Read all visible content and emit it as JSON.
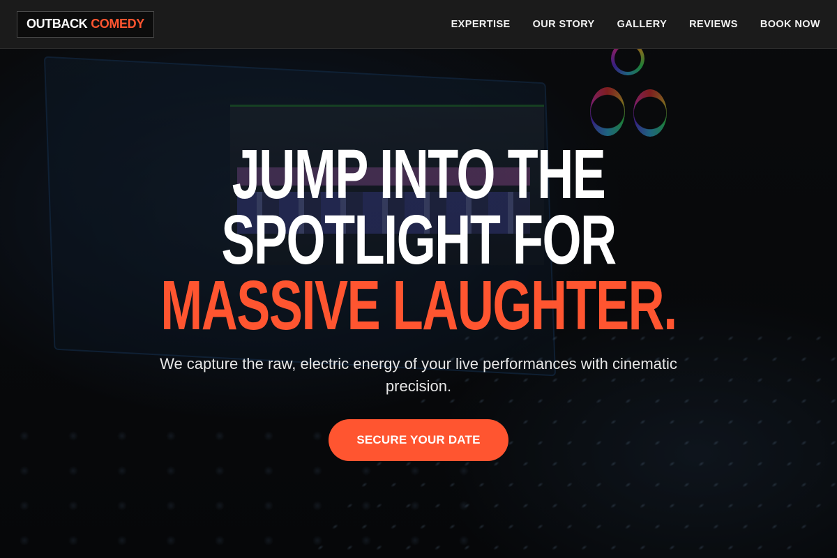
{
  "header": {
    "logo_part1": "OUTBACK",
    "logo_part2": "COMEDY",
    "nav": [
      {
        "label": "EXPERTISE"
      },
      {
        "label": "OUR STORY"
      },
      {
        "label": "GALLERY"
      },
      {
        "label": "REVIEWS"
      },
      {
        "label": "BOOK NOW"
      }
    ]
  },
  "hero": {
    "line1": "JUMP INTO THE",
    "line2": "SPOTLIGHT FOR",
    "line3": "MASSIVE LAUGHTER.",
    "subtitle": "We capture the raw, electric energy of your live performances with cinematic precision.",
    "cta_label": "SECURE YOUR DATE"
  },
  "colors": {
    "accent": "#ff5530",
    "header_bg": "#1b1b1b",
    "text": "#ffffff"
  }
}
